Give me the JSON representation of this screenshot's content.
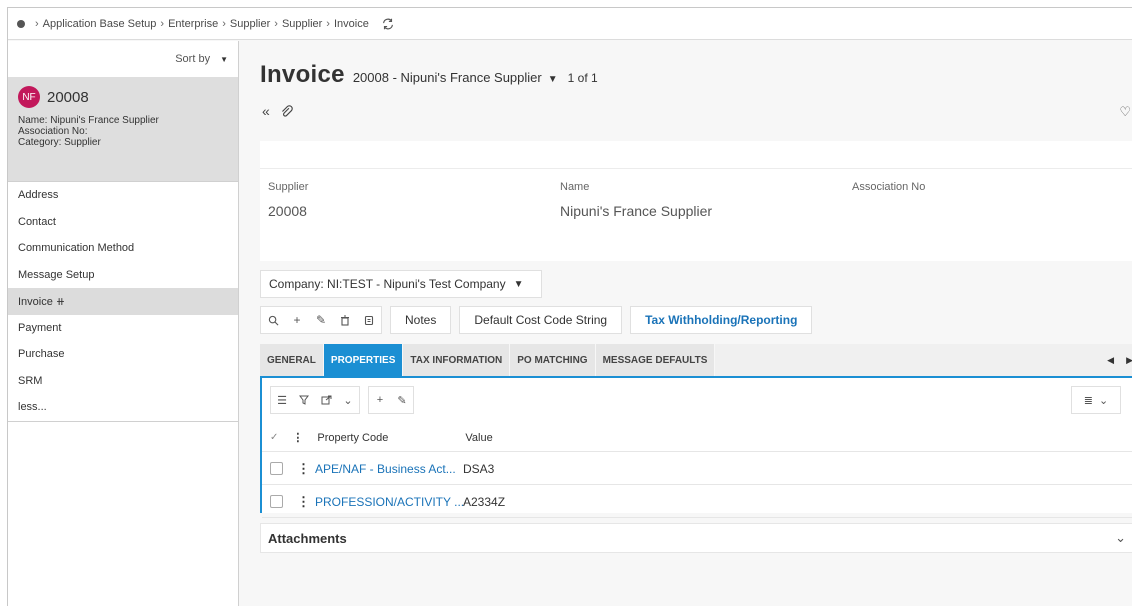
{
  "breadcrumb": {
    "items": [
      "Application Base Setup",
      "Enterprise",
      "Supplier",
      "Supplier",
      "Invoice"
    ]
  },
  "left": {
    "sort_label": "Sort by",
    "card": {
      "initials": "NF",
      "id": "20008",
      "name_line": "Name:  Nipuni's France Supplier",
      "assoc_line": "Association No:",
      "category_line": "Category:  Supplier"
    },
    "nav": [
      {
        "label": "Address"
      },
      {
        "label": "Contact"
      },
      {
        "label": "Communication Method"
      },
      {
        "label": "Message Setup"
      },
      {
        "label": "Invoice ⧺"
      },
      {
        "label": "Payment"
      },
      {
        "label": "Purchase"
      },
      {
        "label": "SRM"
      },
      {
        "label": "less..."
      }
    ]
  },
  "main": {
    "title": "Invoice",
    "record": "20008 - Nipuni's France Supplier",
    "count": "1 of 1",
    "fields": {
      "supplier_label": "Supplier",
      "supplier_value": "20008",
      "name_label": "Name",
      "name_value": "Nipuni's France Supplier",
      "assoc_label": "Association No",
      "assoc_value": ""
    },
    "company": "Company: NI:TEST - Nipuni's Test Company",
    "buttons": {
      "notes": "Notes",
      "cost_code": "Default Cost Code String",
      "tax": "Tax Withholding/Reporting"
    },
    "tabs": [
      {
        "label": "GENERAL"
      },
      {
        "label": "PROPERTIES"
      },
      {
        "label": "TAX INFORMATION"
      },
      {
        "label": "PO MATCHING"
      },
      {
        "label": "MESSAGE DEFAULTS"
      }
    ],
    "grid": {
      "col_code": "Property Code",
      "col_value": "Value",
      "rows": [
        {
          "code": "APE/NAF - Business Act...",
          "value": "DSA3"
        },
        {
          "code": "PROFESSION/ACTIVITY ...",
          "value": "A2334Z"
        }
      ]
    },
    "attachments": "Attachments"
  },
  "colors": {
    "accent": "#1b8fd3",
    "link": "#1a73b8",
    "avatar": "#c2185b"
  }
}
